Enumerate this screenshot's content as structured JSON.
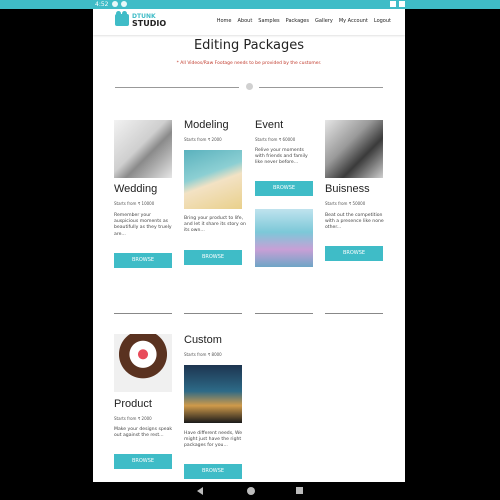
{
  "status_bar": {
    "time": "4:52"
  },
  "brand": {
    "line1": "DTUNK",
    "line2": "STUDIO"
  },
  "nav": [
    "Home",
    "About",
    "Samples",
    "Packages",
    "Gallery",
    "My Account",
    "Logout"
  ],
  "page": {
    "title": "Editing Packages",
    "notice": "* All Videos/Raw Footage needs to be provided by the customer."
  },
  "packages": [
    {
      "name": "Wedding",
      "price": "Starts from ₹ 10000",
      "desc": "Remember your auspicious moments as beautifully as they truely are...",
      "button": "BROWSE"
    },
    {
      "name": "Modeling",
      "price": "Starts from ₹ 2000",
      "desc": "Bring your product to life, and let it share its story on its own...",
      "button": "BROWSE"
    },
    {
      "name": "Event",
      "price": "Starts from ₹ 60000",
      "desc": "Relive your moments with friends and family like never before...",
      "button": "BROWSE"
    },
    {
      "name": "Buisness",
      "price": "Starts from ₹ 50000",
      "desc": "Beat out the competition with a presence like none other...",
      "button": "BROWSE"
    },
    {
      "name": "Product",
      "price": "Starts from ₹ 2000",
      "desc": "Make your designs speak out against the rest...",
      "button": "BROWSE"
    },
    {
      "name": "Custom",
      "price": "Starts from ₹ 8000",
      "desc": "Have different needs, We might just have the right packages for you...",
      "button": "BROWSE"
    }
  ],
  "colors": {
    "accent": "#3fbcc7",
    "notice": "#c0392b",
    "text": "#222222"
  }
}
